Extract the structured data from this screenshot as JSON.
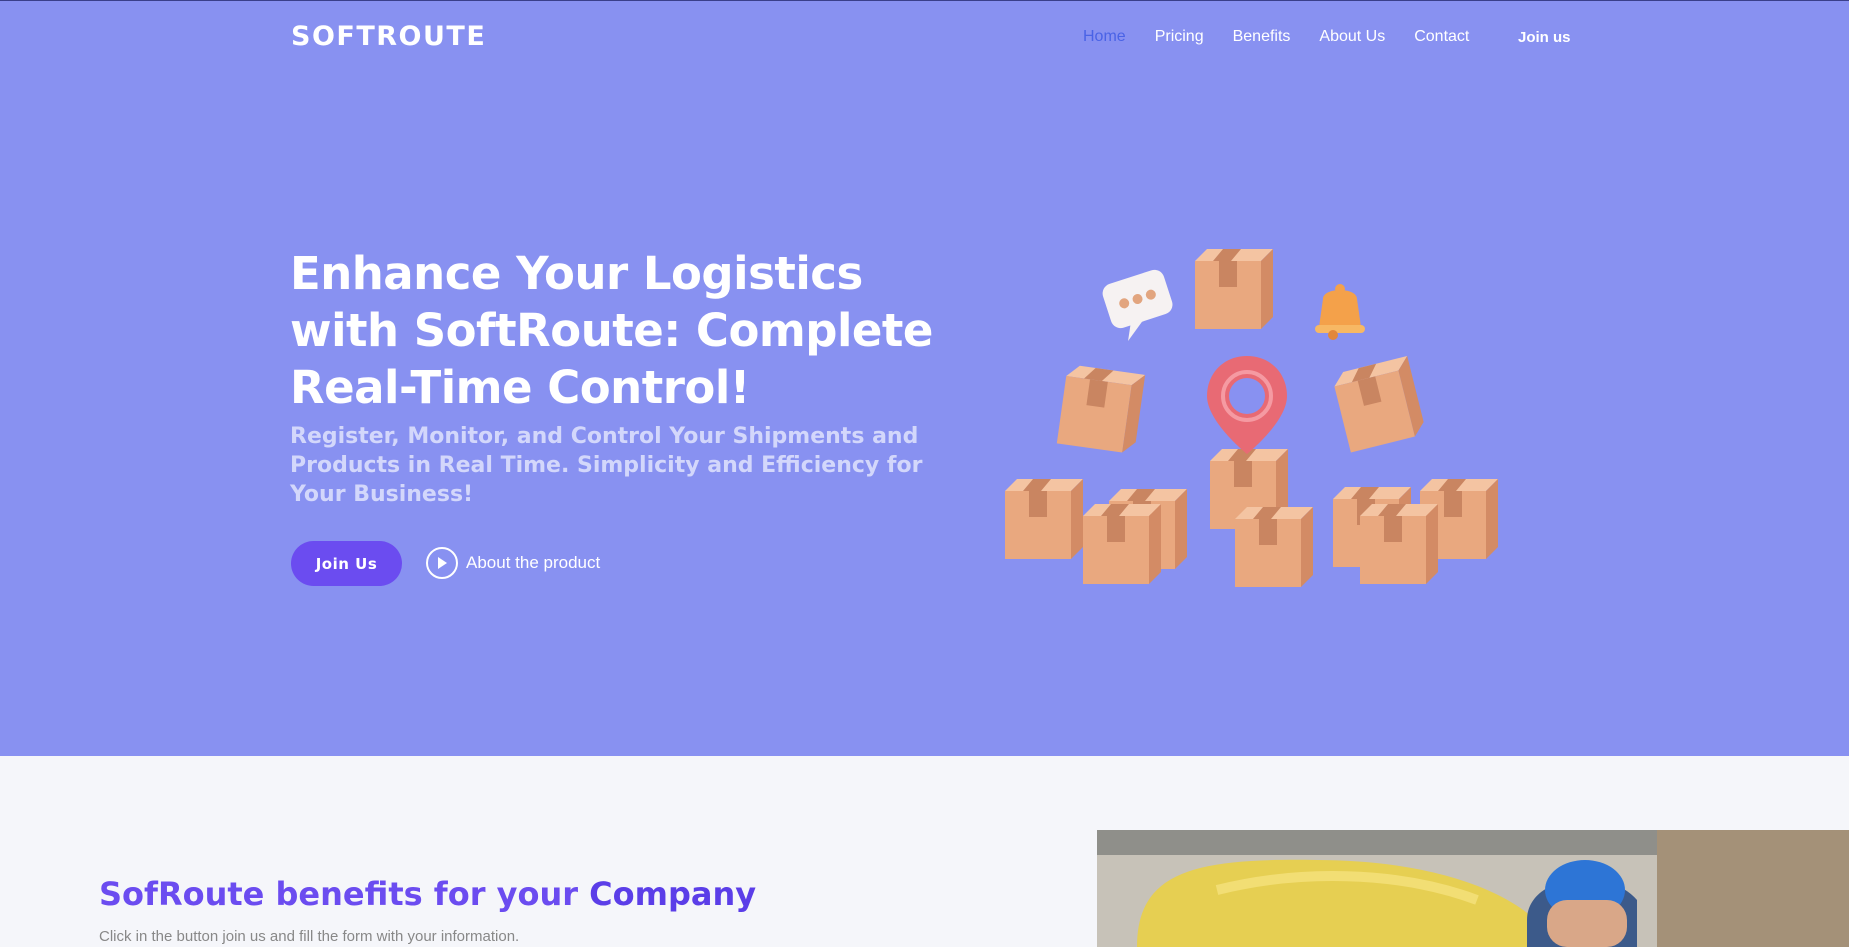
{
  "header": {
    "logo": "SOFTROUTE",
    "nav": [
      "Home",
      "Pricing",
      "Benefits",
      "About Us",
      "Contact"
    ],
    "join_label": "Join us"
  },
  "hero": {
    "title": "Enhance Your Logistics with SoftRoute: Complete Real-Time Control!",
    "subtitle": "Register, Monitor, and Control Your Shipments and Products in Real Time. Simplicity and Efficiency for Your Business!",
    "join_button": "Join Us",
    "about_link": "About the product"
  },
  "benefits": {
    "title_prefix": "SofRoute benefits for your ",
    "title_bold": "Company",
    "subtitle": "Click in the button join us and fill the form with your information."
  },
  "colors": {
    "hero_bg": "#8891f1",
    "accent": "#6b4cf0",
    "active_nav": "#4a63e6"
  },
  "icons": [
    "play-icon",
    "location-pin-icon",
    "bell-icon",
    "chat-bubble-icon",
    "box-icon"
  ]
}
